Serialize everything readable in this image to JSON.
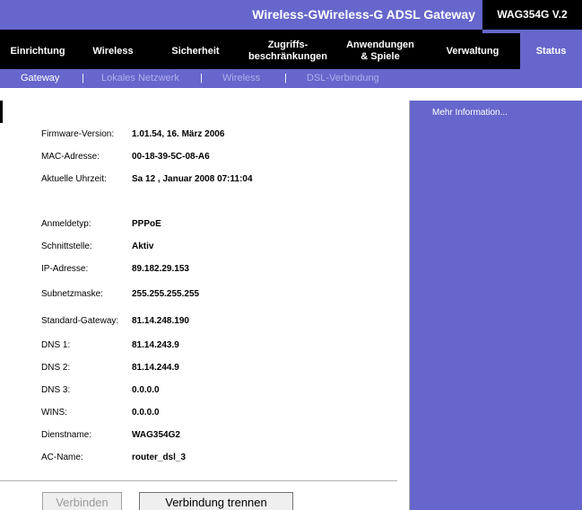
{
  "header": {
    "title": "Wireless-GWireless-G ADSL Gateway",
    "model": "WAG354G V.2"
  },
  "tabs": [
    {
      "label": "Einrichtung",
      "active": false
    },
    {
      "label": "Wireless",
      "active": false
    },
    {
      "label": "Sicherheit",
      "active": false
    },
    {
      "label": "Zugriffs-\nbeschränkungen",
      "active": false
    },
    {
      "label": "Anwendungen\n& Spiele",
      "active": false
    },
    {
      "label": "Verwaltung",
      "active": false
    },
    {
      "label": "Status",
      "active": true
    }
  ],
  "subnav": {
    "items": [
      "Gateway",
      "Lokales Netzwerk",
      "Wireless",
      "DSL-Verbindung"
    ],
    "active": "Gateway",
    "separator": "|"
  },
  "info": {
    "firmware_label": "Firmware-Version:",
    "firmware_value": "1.01.54, 16. März 2006",
    "mac_label": "MAC-Adresse:",
    "mac_value": "00-18-39-5C-08-A6",
    "time_label": "Aktuelle Uhrzeit:",
    "time_value": "Sa 12 , Januar 2008 07:11:04",
    "login_label": "Anmeldetyp:",
    "login_value": "PPPoE",
    "interface_label": "Schnittstelle:",
    "interface_value": "Aktiv",
    "ip_label": "IP-Adresse:",
    "ip_value": "89.182.29.153",
    "subnet_label": "Subnetzmaske:",
    "subnet_value": "255.255.255.255",
    "gateway_label": "Standard-Gateway:",
    "gateway_value": "81.14.248.190",
    "dns1_label": "DNS 1:",
    "dns1_value": "81.14.243.9",
    "dns2_label": "DNS 2:",
    "dns2_value": "81.14.244.9",
    "dns3_label": "DNS 3:",
    "dns3_value": "0.0.0.0",
    "wins_label": "WINS:",
    "wins_value": "0.0.0.0",
    "service_label": "Dienstname:",
    "service_value": "WAG354G2",
    "ac_label": "AC-Name:",
    "ac_value": "router_dsl_3"
  },
  "buttons": {
    "connect": "Verbinden",
    "connect_enabled": false,
    "disconnect": "Verbindung trennen"
  },
  "help": {
    "more": "Mehr Information..."
  },
  "colors": {
    "brand_purple": "#6666cc",
    "nav_black": "#000000",
    "inactive_subnav": "#b0b0ec"
  }
}
